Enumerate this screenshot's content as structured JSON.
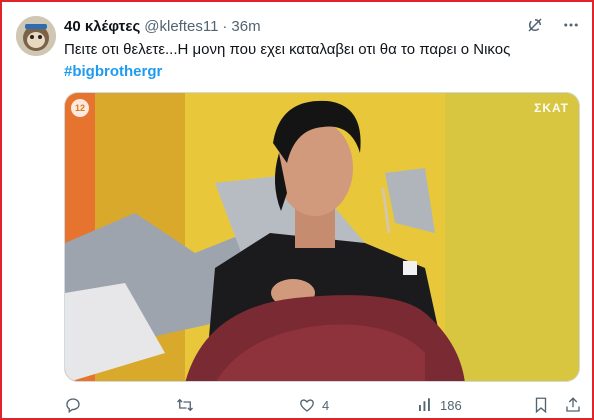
{
  "tweet": {
    "author_name": "40 κλέφτες",
    "handle": "@kleftes11",
    "separator": "·",
    "time": "36m",
    "text": "Πειτε οτι θελετε...Η μονη που εχει καταλαβει οτι θα το παρει ο Νικος",
    "hashtag": "#bigbrothergr"
  },
  "media": {
    "channel_logo": "ΣΚΑΤ",
    "rating_badge": "12"
  },
  "actions": {
    "reply_count": "",
    "retweet_count": "",
    "like_count": "4",
    "views_count": "186"
  },
  "icons": {
    "top": [
      "grok-icon",
      "more-icon"
    ],
    "actions": [
      "reply-icon",
      "retweet-icon",
      "like-icon",
      "views-icon",
      "bookmark-icon",
      "share-icon"
    ]
  },
  "colors": {
    "link": "#1d9bf0",
    "secondary_text": "#536471",
    "frame": "#e0242c"
  }
}
